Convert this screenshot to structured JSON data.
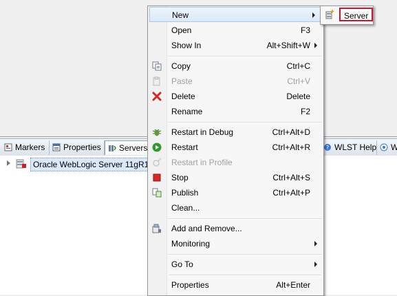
{
  "tabs": [
    {
      "label": "Markers",
      "icon": "markers-icon"
    },
    {
      "label": "Properties",
      "icon": "properties-icon"
    },
    {
      "label": "Servers",
      "icon": "servers-icon"
    },
    {
      "label": "WLST Help",
      "icon": "help-icon"
    },
    {
      "label": "W",
      "icon": "wlst-icon"
    }
  ],
  "tree": {
    "server_label": "Oracle WebLogic Server 11gR1 ("
  },
  "menu": {
    "items": [
      {
        "label": "New",
        "accel": "",
        "submenu": true
      },
      {
        "label": "Open",
        "accel": "F3"
      },
      {
        "label": "Show In",
        "accel": "Alt+Shift+W",
        "submenu": true
      },
      {
        "label": "Copy",
        "accel": "Ctrl+C",
        "icon": "copy-icon"
      },
      {
        "label": "Paste",
        "accel": "Ctrl+V",
        "icon": "paste-icon",
        "disabled": true
      },
      {
        "label": "Delete",
        "accel": "Delete",
        "icon": "delete-icon"
      },
      {
        "label": "Rename",
        "accel": "F2"
      },
      {
        "label": "Restart in Debug",
        "accel": "Ctrl+Alt+D",
        "icon": "debug-icon"
      },
      {
        "label": "Restart",
        "accel": "Ctrl+Alt+R",
        "icon": "run-icon"
      },
      {
        "label": "Restart in Profile",
        "accel": "",
        "icon": "profile-icon",
        "disabled": true
      },
      {
        "label": "Stop",
        "accel": "Ctrl+Alt+S",
        "icon": "stop-icon"
      },
      {
        "label": "Publish",
        "accel": "Ctrl+Alt+P",
        "icon": "publish-icon"
      },
      {
        "label": "Clean...",
        "accel": ""
      },
      {
        "label": "Add and Remove...",
        "accel": "",
        "icon": "add-remove-icon"
      },
      {
        "label": "Monitoring",
        "accel": "",
        "submenu": true
      },
      {
        "label": "Go To",
        "accel": "",
        "submenu": true
      },
      {
        "label": "Properties",
        "accel": "Alt+Enter"
      }
    ]
  },
  "submenu": {
    "server_label": "Server"
  },
  "colors": {
    "highlight_border": "#d0152b",
    "selection_bg": "#d9e8fb"
  }
}
